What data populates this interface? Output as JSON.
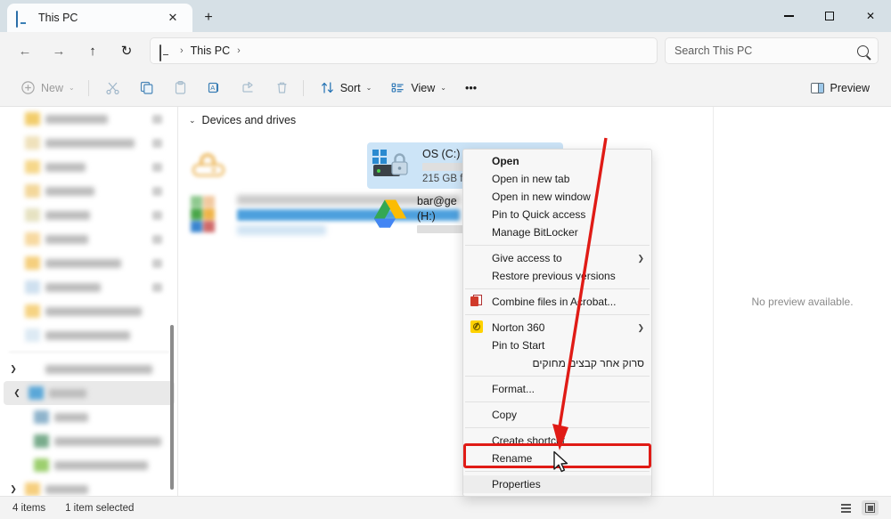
{
  "window": {
    "tab_title": "This PC",
    "tab_icon": "monitor-icon",
    "new_tab_label": "+",
    "close_tab_label": "✕",
    "minimize_label": "",
    "maximize_label": "",
    "close_label": "✕"
  },
  "nav": {
    "back_label": "←",
    "forward_label": "→",
    "up_label": "↑",
    "refresh_label": "↻",
    "breadcrumb_root_icon": "this-pc-icon",
    "breadcrumb": [
      "This PC"
    ],
    "separator": "›"
  },
  "search": {
    "placeholder": "Search This PC",
    "value": "",
    "icon": "search-icon"
  },
  "toolbar": {
    "new_label": "New",
    "cut_label": "",
    "copy_label": "",
    "paste_label": "",
    "rename_label": "",
    "share_label": "",
    "delete_label": "",
    "sort_label": "Sort",
    "view_label": "View",
    "more_label": "•••",
    "preview_label": "Preview",
    "chevron": "⌄",
    "icons": {
      "new": "plus-circle-icon",
      "cut": "scissors-icon",
      "copy": "copy-icon",
      "paste": "clipboard-icon",
      "rename": "rename-icon",
      "share": "share-icon",
      "delete": "trash-icon",
      "sort": "sort-arrows-icon",
      "view": "view-list-icon",
      "more": "ellipsis-icon",
      "preview": "preview-pane-icon"
    }
  },
  "content": {
    "group_header": "Devices and drives",
    "group_chevron": "⌄",
    "drives": [
      {
        "name": "OS (C:)",
        "sub": "215 GB f",
        "fill_percent": 62,
        "icon": "windows-drive-icon",
        "selected": true
      },
      {
        "name": "bar@ge",
        "name2": "(H:)",
        "sub": "",
        "fill_percent": 100,
        "icon": "google-drive-icon",
        "selected": false
      }
    ]
  },
  "preview_pane": {
    "message": "No preview available."
  },
  "context_menu": {
    "items": [
      {
        "label": "Open",
        "bold": true,
        "icon": null,
        "submenu": false
      },
      {
        "label": "Open in new tab",
        "bold": false,
        "icon": null,
        "submenu": false
      },
      {
        "label": "Open in new window",
        "bold": false,
        "icon": null,
        "submenu": false
      },
      {
        "label": "Pin to Quick access",
        "bold": false,
        "icon": null,
        "submenu": false
      },
      {
        "label": "Manage BitLocker",
        "bold": false,
        "icon": null,
        "submenu": false
      },
      {
        "separator": true
      },
      {
        "label": "Give access to",
        "bold": false,
        "icon": null,
        "submenu": true
      },
      {
        "label": "Restore previous versions",
        "bold": false,
        "icon": null,
        "submenu": false
      },
      {
        "separator": true
      },
      {
        "label": "Combine files in Acrobat...",
        "bold": false,
        "icon": "acrobat-icon",
        "submenu": false
      },
      {
        "separator": true
      },
      {
        "label": "Norton 360",
        "bold": false,
        "icon": "norton-icon",
        "submenu": true
      },
      {
        "label": "Pin to Start",
        "bold": false,
        "icon": null,
        "submenu": false
      },
      {
        "label": "סרוק אחר קבצים מחוקים",
        "bold": false,
        "icon": null,
        "submenu": false,
        "rtl": true
      },
      {
        "separator": true
      },
      {
        "label": "Format...",
        "bold": false,
        "icon": null,
        "submenu": false
      },
      {
        "separator": true
      },
      {
        "label": "Copy",
        "bold": false,
        "icon": null,
        "submenu": false
      },
      {
        "separator": true
      },
      {
        "label": "Create shortcut",
        "bold": false,
        "icon": null,
        "submenu": false
      },
      {
        "label": "Rename",
        "bold": false,
        "icon": null,
        "submenu": false
      },
      {
        "separator": true
      },
      {
        "label": "Properties",
        "bold": false,
        "icon": null,
        "submenu": false,
        "highlighted": true
      }
    ]
  },
  "status": {
    "item_count": "4 items",
    "selection": "1 item selected",
    "view_details_icon": "details-view-icon",
    "view_tiles_icon": "large-icons-view-icon"
  },
  "annotations": {
    "highlight_color": "#e01b16",
    "arrow_color": "#e01b16",
    "cursor": "arrow-pointer"
  }
}
